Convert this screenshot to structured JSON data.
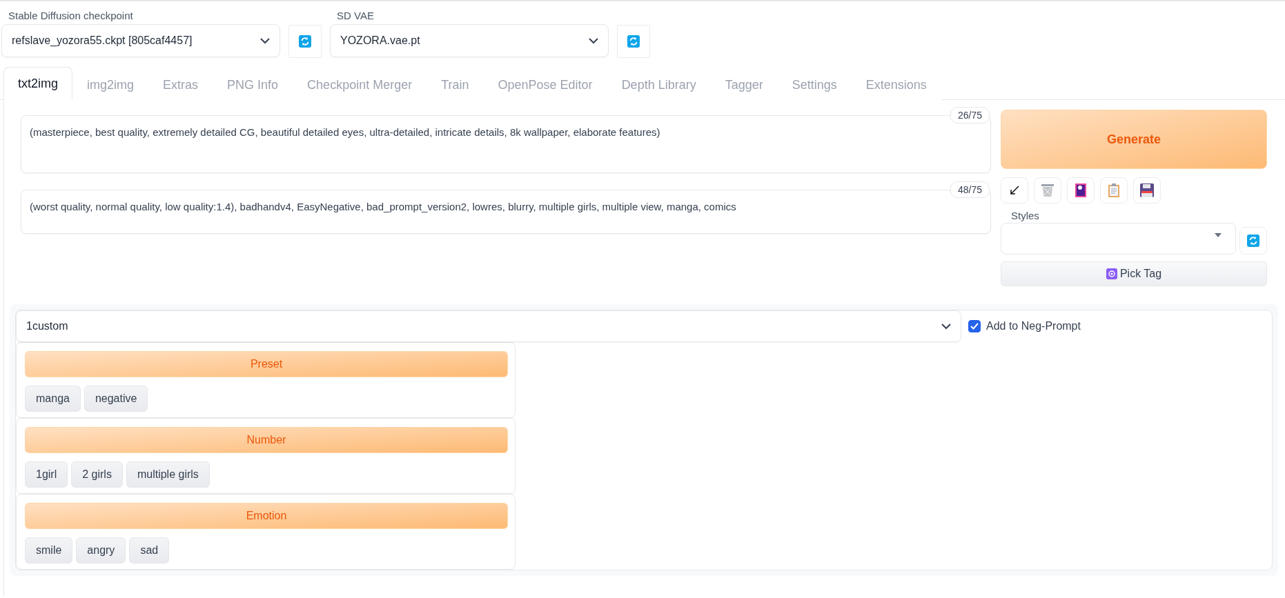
{
  "model_selectors": [
    {
      "label": "Stable Diffusion checkpoint",
      "value": "refslave_yozora55.ckpt [805caf4457]"
    },
    {
      "label": "SD VAE",
      "value": "YOZORA.vae.pt"
    }
  ],
  "tabs": [
    {
      "label": "txt2img",
      "selected": true
    },
    {
      "label": "img2img",
      "selected": false
    },
    {
      "label": "Extras",
      "selected": false
    },
    {
      "label": "PNG Info",
      "selected": false
    },
    {
      "label": "Checkpoint Merger",
      "selected": false
    },
    {
      "label": "Train",
      "selected": false
    },
    {
      "label": "OpenPose Editor",
      "selected": false
    },
    {
      "label": "Depth Library",
      "selected": false
    },
    {
      "label": "Tagger",
      "selected": false
    },
    {
      "label": "Settings",
      "selected": false
    },
    {
      "label": "Extensions",
      "selected": false
    }
  ],
  "prompts": [
    {
      "counter": "26/75",
      "value": "(masterpiece, best quality, extremely detailed CG, beautiful detailed eyes, ultra-detailed, intricate details, 8k wallpaper, elaborate features)"
    },
    {
      "counter": "48/75",
      "value": "(worst quality, normal quality, low quality:1.4), badhandv4, EasyNegative, bad_prompt_version2, lowres, blurry, multiple girls, multiple view, manga, comics"
    }
  ],
  "generate_button": "Generate",
  "tool_buttons": [
    {
      "kind": "arrow"
    },
    {
      "kind": "trash"
    },
    {
      "kind": "picture"
    },
    {
      "kind": "clipboard"
    },
    {
      "kind": "save"
    }
  ],
  "styles": {
    "label": "Styles"
  },
  "pick_tag_button": "Pick Tag",
  "tag_panel": {
    "preset_select": "1custom",
    "add_to_negative": {
      "label": "Add to Neg-Prompt",
      "checked": true
    },
    "groups": [
      {
        "title": "Preset",
        "tags": [
          "manga",
          "negative"
        ]
      },
      {
        "title": "Number",
        "tags": [
          "1girl",
          "2 girls",
          "multiple girls"
        ]
      },
      {
        "title": "Emotion",
        "tags": [
          "smile",
          "angry",
          "sad"
        ]
      }
    ]
  }
}
